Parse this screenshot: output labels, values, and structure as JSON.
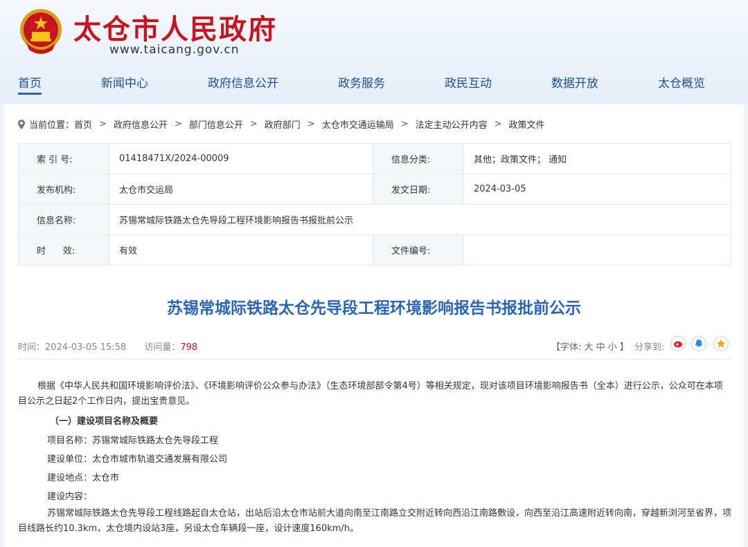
{
  "header": {
    "site_title": "太仓市人民政府",
    "site_url": "www.taicang.gov.cn"
  },
  "nav": {
    "items": [
      "首页",
      "新闻中心",
      "政府信息公开",
      "政务服务",
      "政民互动",
      "数据开放",
      "太仓概览"
    ]
  },
  "breadcrumb": {
    "prefix": "当前位置：",
    "items": [
      "首页",
      "政府信息公开",
      "部门信息公开",
      "政府部门",
      "太仓市交通运输局",
      "法定主动公开内容",
      "政策文件"
    ],
    "separator": ">"
  },
  "meta": {
    "index_label": "索 引 号:",
    "index_value": "01418471X/2024-00009",
    "category_label": "信息分类:",
    "category_value": "其他；政策文件；  通知",
    "publisher_label": "发布机构:",
    "publisher_value": "太仓市交运局",
    "date_label": "发文日期:",
    "date_value": "2024-03-05",
    "name_label": "信息名称:",
    "name_value": "苏锡常城际铁路太仓先导段工程环境影响报告书报批前公示",
    "validity_label": "时      效:",
    "validity_value": "有效",
    "docno_label": "文件编号:",
    "docno_value": ""
  },
  "article": {
    "title": "苏锡常城际铁路太仓先导段工程环境影响报告书报批前公示",
    "time_label": "时间：",
    "time_value": "2024-03-05 15:58",
    "hits_label": "访问量：",
    "hits_value": "798",
    "font_ctrl": "【字体: 大  中  小 】",
    "share_label": "分享到:",
    "para1": "根据《中华人民共和国环境影响评价法》、《环境影响评价公众参与办法》（生态环境部部令第4号）等相关规定，现对该项目环境影响报告书（全本）进行公示，公众可在本项目公示之日起2个工作日内，提出宝贵意见。",
    "section1": "（一）建设项目名称及概要",
    "project_name": "项目名称：苏锡常城际铁路太仓先导段工程",
    "builder": "建设单位：太仓市城市轨道交通发展有限公司",
    "location": "建设地点：太仓市",
    "content_label": "建设内容：",
    "para2": "苏锡常城际铁路太仓先导段工程线路起自太仓站，出站后沿太仓市站前大道向南至江南路立交附近转向西沿江南路敷设，向西至沿江高速附近转向南，穿越新浏河至省界，项目线路长约10.3km，太仓境内设站3座，另设太仓车辆段一座，设计速度160km/h。"
  },
  "colors": {
    "brand_red": "#c8141e",
    "nav_blue": "#1f4f8f",
    "title_blue": "#2a64b8"
  }
}
